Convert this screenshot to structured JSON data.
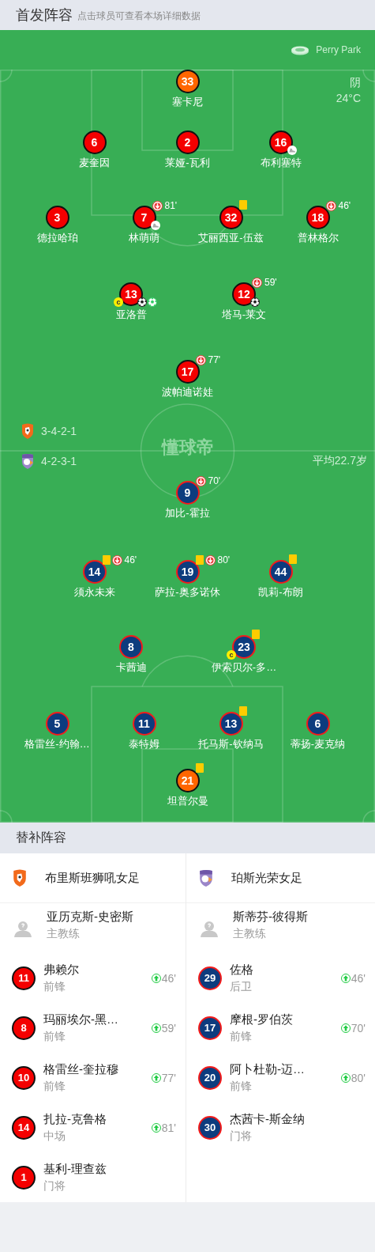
{
  "header": {
    "title": "首发阵容",
    "hint": "点击球员可查看本场详细数据"
  },
  "venue": "Perry Park",
  "weather": {
    "condition": "阴",
    "temperature": "24°C"
  },
  "pitch_logo": "懂球帝",
  "home": {
    "color": "#f40000",
    "formation": "3-4-2-1",
    "rows": [
      [
        {
          "number": "33",
          "name": "塞卡尼",
          "kind": "goalkeeper"
        }
      ],
      [
        {
          "number": "6",
          "name": "麦奎因",
          "kind": "outfield"
        },
        {
          "number": "2",
          "name": "莱娅-瓦利",
          "kind": "outfield"
        },
        {
          "number": "16",
          "name": "布利塞特",
          "kind": "outfield",
          "events": [
            {
              "kind": "assist"
            }
          ]
        }
      ],
      [
        {
          "number": "3",
          "name": "德拉哈珀",
          "kind": "outfield"
        },
        {
          "number": "7",
          "name": "林萌萌",
          "kind": "outfield",
          "events": [
            {
              "kind": "sub_off",
              "minute": "81'"
            },
            {
              "kind": "assist"
            }
          ]
        },
        {
          "number": "32",
          "name": "艾丽西亚-伍兹",
          "kind": "outfield",
          "events": [
            {
              "kind": "yellow_card"
            }
          ]
        },
        {
          "number": "18",
          "name": "普林格尔",
          "kind": "outfield",
          "events": [
            {
              "kind": "sub_off",
              "minute": "46'"
            }
          ]
        }
      ],
      [
        {
          "number": "13",
          "name": "亚洛普",
          "kind": "outfield",
          "events": [
            {
              "kind": "captain",
              "label": "c"
            },
            {
              "kind": "goal"
            },
            {
              "kind": "light_goal"
            }
          ]
        },
        {
          "number": "12",
          "name": "塔马-莱文",
          "kind": "outfield",
          "events": [
            {
              "kind": "sub_off",
              "minute": "59'"
            },
            {
              "kind": "goal"
            }
          ]
        }
      ],
      [
        {
          "number": "17",
          "name": "波帕迪诺娃",
          "kind": "outfield",
          "events": [
            {
              "kind": "sub_off",
              "minute": "77'"
            }
          ]
        }
      ]
    ]
  },
  "away": {
    "color": "#0d3c7e",
    "formation": "4-2-3-1",
    "average_age": "平均22.7岁",
    "rows": [
      [
        {
          "number": "9",
          "name": "加比-霍拉",
          "kind": "outfield",
          "events": [
            {
              "kind": "sub_off",
              "minute": "70'"
            }
          ]
        }
      ],
      [
        {
          "number": "14",
          "name": "须永未来",
          "kind": "outfield",
          "events": [
            {
              "kind": "yellow_card"
            },
            {
              "kind": "sub_off",
              "minute": "46'"
            }
          ]
        },
        {
          "number": "19",
          "name": "萨拉-奥多诺休",
          "kind": "outfield",
          "events": [
            {
              "kind": "yellow_card"
            },
            {
              "kind": "sub_off",
              "minute": "80'"
            }
          ]
        },
        {
          "number": "44",
          "name": "凯莉-布朗",
          "kind": "outfield",
          "events": [
            {
              "kind": "yellow_card"
            }
          ]
        }
      ],
      [
        {
          "number": "8",
          "name": "卡茜迪",
          "kind": "outfield"
        },
        {
          "number": "23",
          "name": "伊索贝尔-多…",
          "kind": "outfield",
          "events": [
            {
              "kind": "yellow_card"
            },
            {
              "kind": "captain",
              "label": "c"
            }
          ]
        }
      ],
      [
        {
          "number": "5",
          "name": "格雷丝-约翰…",
          "kind": "outfield"
        },
        {
          "number": "11",
          "name": "泰特姆",
          "kind": "outfield"
        },
        {
          "number": "13",
          "name": "托马斯-钦纳马",
          "kind": "outfield",
          "events": [
            {
              "kind": "yellow_card"
            }
          ]
        },
        {
          "number": "6",
          "name": "蒂扬-麦克纳",
          "kind": "outfield"
        }
      ],
      [
        {
          "number": "21",
          "name": "坦普尔曼",
          "kind": "goalkeeper",
          "events": [
            {
              "kind": "yellow_card"
            }
          ]
        }
      ]
    ]
  },
  "substitutes": {
    "title": "替补阵容",
    "teams": [
      {
        "color": "#f40000",
        "name": "布里斯班狮吼女足",
        "coach": {
          "name": "亚历克斯-史密斯",
          "role": "主教练"
        },
        "players": [
          {
            "number": "11",
            "name": "弗赖尔",
            "position": "前锋",
            "sub_in": "46'"
          },
          {
            "number": "8",
            "name": "玛丽埃尔-黑…",
            "position": "前锋",
            "sub_in": "59'"
          },
          {
            "number": "10",
            "name": "格雷丝-奎拉穆",
            "position": "前锋",
            "sub_in": "77'"
          },
          {
            "number": "14",
            "name": "扎拉-克鲁格",
            "position": "中场",
            "sub_in": "81'"
          },
          {
            "number": "1",
            "name": "基利-理查兹",
            "position": "门将"
          }
        ]
      },
      {
        "color": "#0d3c7e",
        "name": "珀斯光荣女足",
        "coach": {
          "name": "斯蒂芬-彼得斯",
          "role": "主教练"
        },
        "players": [
          {
            "number": "29",
            "name": "佐格",
            "position": "后卫",
            "sub_in": "46'"
          },
          {
            "number": "17",
            "name": "摩根-罗伯茨",
            "position": "前锋",
            "sub_in": "70'"
          },
          {
            "number": "20",
            "name": "阿卜杜勒-迈…",
            "position": "前锋",
            "sub_in": "80'"
          },
          {
            "number": "30",
            "name": "杰茜卡-斯金纳",
            "position": "门将"
          }
        ]
      }
    ]
  }
}
